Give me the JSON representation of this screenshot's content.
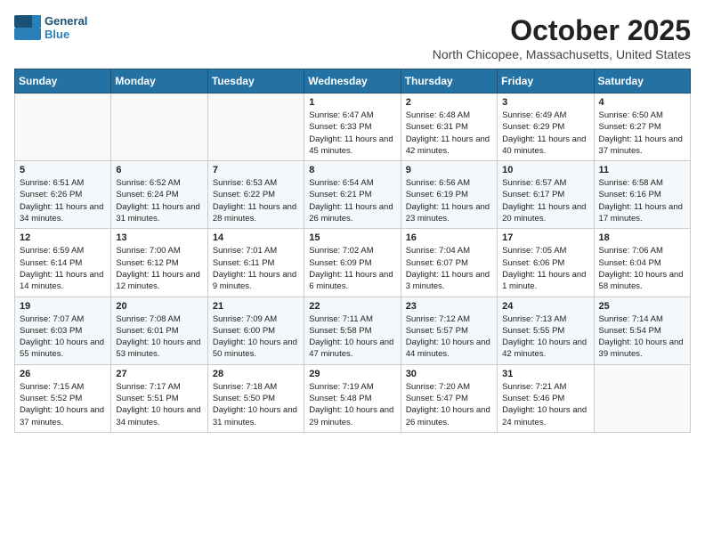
{
  "header": {
    "logo_line1": "General",
    "logo_line2": "Blue",
    "month_title": "October 2025",
    "location": "North Chicopee, Massachusetts, United States"
  },
  "calendar": {
    "days_of_week": [
      "Sunday",
      "Monday",
      "Tuesday",
      "Wednesday",
      "Thursday",
      "Friday",
      "Saturday"
    ],
    "weeks": [
      [
        {
          "day": "",
          "info": ""
        },
        {
          "day": "",
          "info": ""
        },
        {
          "day": "",
          "info": ""
        },
        {
          "day": "1",
          "info": "Sunrise: 6:47 AM\nSunset: 6:33 PM\nDaylight: 11 hours and 45 minutes."
        },
        {
          "day": "2",
          "info": "Sunrise: 6:48 AM\nSunset: 6:31 PM\nDaylight: 11 hours and 42 minutes."
        },
        {
          "day": "3",
          "info": "Sunrise: 6:49 AM\nSunset: 6:29 PM\nDaylight: 11 hours and 40 minutes."
        },
        {
          "day": "4",
          "info": "Sunrise: 6:50 AM\nSunset: 6:27 PM\nDaylight: 11 hours and 37 minutes."
        }
      ],
      [
        {
          "day": "5",
          "info": "Sunrise: 6:51 AM\nSunset: 6:26 PM\nDaylight: 11 hours and 34 minutes."
        },
        {
          "day": "6",
          "info": "Sunrise: 6:52 AM\nSunset: 6:24 PM\nDaylight: 11 hours and 31 minutes."
        },
        {
          "day": "7",
          "info": "Sunrise: 6:53 AM\nSunset: 6:22 PM\nDaylight: 11 hours and 28 minutes."
        },
        {
          "day": "8",
          "info": "Sunrise: 6:54 AM\nSunset: 6:21 PM\nDaylight: 11 hours and 26 minutes."
        },
        {
          "day": "9",
          "info": "Sunrise: 6:56 AM\nSunset: 6:19 PM\nDaylight: 11 hours and 23 minutes."
        },
        {
          "day": "10",
          "info": "Sunrise: 6:57 AM\nSunset: 6:17 PM\nDaylight: 11 hours and 20 minutes."
        },
        {
          "day": "11",
          "info": "Sunrise: 6:58 AM\nSunset: 6:16 PM\nDaylight: 11 hours and 17 minutes."
        }
      ],
      [
        {
          "day": "12",
          "info": "Sunrise: 6:59 AM\nSunset: 6:14 PM\nDaylight: 11 hours and 14 minutes."
        },
        {
          "day": "13",
          "info": "Sunrise: 7:00 AM\nSunset: 6:12 PM\nDaylight: 11 hours and 12 minutes."
        },
        {
          "day": "14",
          "info": "Sunrise: 7:01 AM\nSunset: 6:11 PM\nDaylight: 11 hours and 9 minutes."
        },
        {
          "day": "15",
          "info": "Sunrise: 7:02 AM\nSunset: 6:09 PM\nDaylight: 11 hours and 6 minutes."
        },
        {
          "day": "16",
          "info": "Sunrise: 7:04 AM\nSunset: 6:07 PM\nDaylight: 11 hours and 3 minutes."
        },
        {
          "day": "17",
          "info": "Sunrise: 7:05 AM\nSunset: 6:06 PM\nDaylight: 11 hours and 1 minute."
        },
        {
          "day": "18",
          "info": "Sunrise: 7:06 AM\nSunset: 6:04 PM\nDaylight: 10 hours and 58 minutes."
        }
      ],
      [
        {
          "day": "19",
          "info": "Sunrise: 7:07 AM\nSunset: 6:03 PM\nDaylight: 10 hours and 55 minutes."
        },
        {
          "day": "20",
          "info": "Sunrise: 7:08 AM\nSunset: 6:01 PM\nDaylight: 10 hours and 53 minutes."
        },
        {
          "day": "21",
          "info": "Sunrise: 7:09 AM\nSunset: 6:00 PM\nDaylight: 10 hours and 50 minutes."
        },
        {
          "day": "22",
          "info": "Sunrise: 7:11 AM\nSunset: 5:58 PM\nDaylight: 10 hours and 47 minutes."
        },
        {
          "day": "23",
          "info": "Sunrise: 7:12 AM\nSunset: 5:57 PM\nDaylight: 10 hours and 44 minutes."
        },
        {
          "day": "24",
          "info": "Sunrise: 7:13 AM\nSunset: 5:55 PM\nDaylight: 10 hours and 42 minutes."
        },
        {
          "day": "25",
          "info": "Sunrise: 7:14 AM\nSunset: 5:54 PM\nDaylight: 10 hours and 39 minutes."
        }
      ],
      [
        {
          "day": "26",
          "info": "Sunrise: 7:15 AM\nSunset: 5:52 PM\nDaylight: 10 hours and 37 minutes."
        },
        {
          "day": "27",
          "info": "Sunrise: 7:17 AM\nSunset: 5:51 PM\nDaylight: 10 hours and 34 minutes."
        },
        {
          "day": "28",
          "info": "Sunrise: 7:18 AM\nSunset: 5:50 PM\nDaylight: 10 hours and 31 minutes."
        },
        {
          "day": "29",
          "info": "Sunrise: 7:19 AM\nSunset: 5:48 PM\nDaylight: 10 hours and 29 minutes."
        },
        {
          "day": "30",
          "info": "Sunrise: 7:20 AM\nSunset: 5:47 PM\nDaylight: 10 hours and 26 minutes."
        },
        {
          "day": "31",
          "info": "Sunrise: 7:21 AM\nSunset: 5:46 PM\nDaylight: 10 hours and 24 minutes."
        },
        {
          "day": "",
          "info": ""
        }
      ]
    ]
  }
}
